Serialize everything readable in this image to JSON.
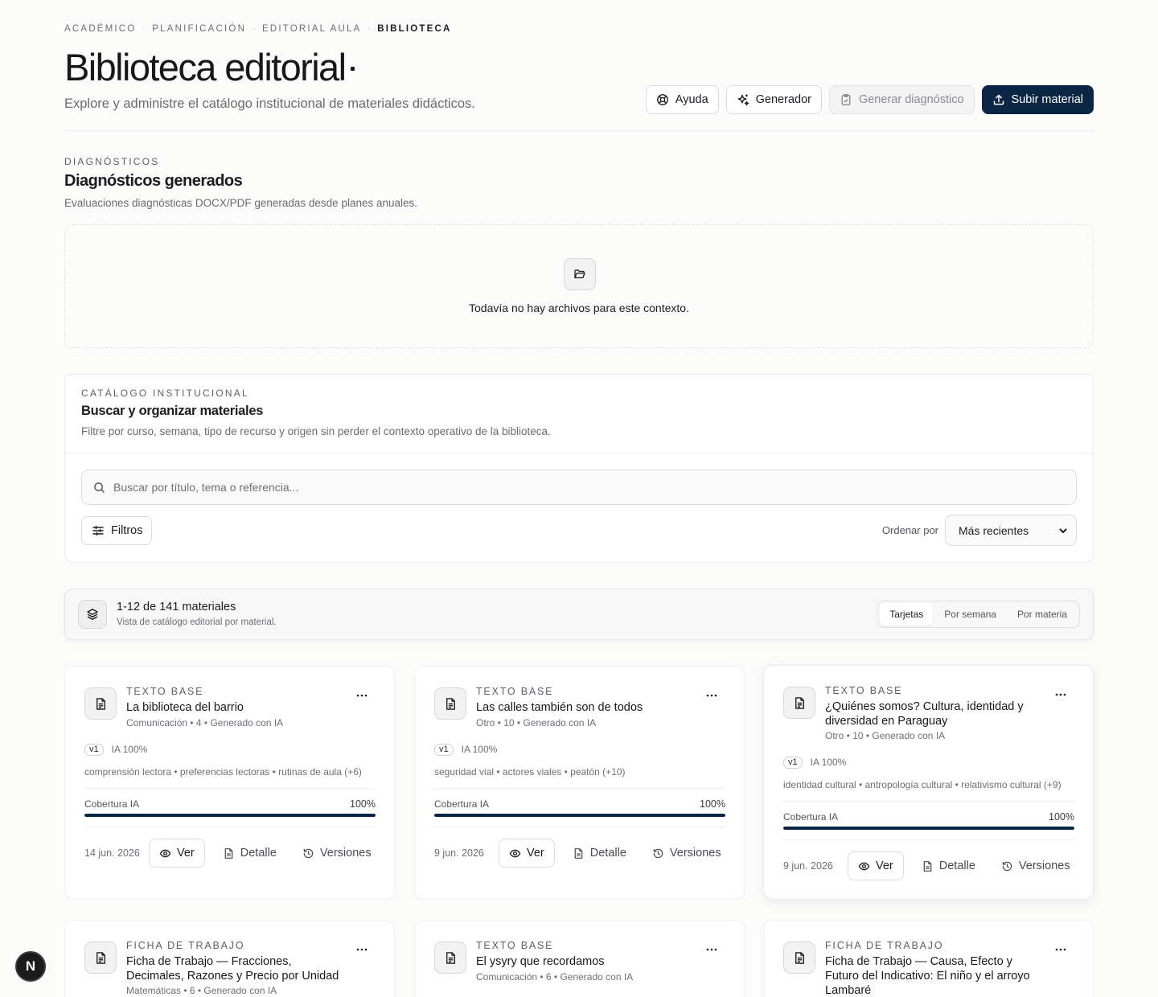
{
  "breadcrumb": [
    "ACADÉMICO",
    "PLANIFICACIÓN",
    "EDITORIAL AULA",
    "BIBLIOTECA"
  ],
  "page": {
    "title": "Biblioteca editorial",
    "subtitle": "Explore y administre el catálogo institucional de materiales didácticos."
  },
  "actions": {
    "help": "Ayuda",
    "generator": "Generador",
    "diagnostic": "Generar diagnóstico",
    "upload": "Subir material"
  },
  "diagnostics": {
    "eyebrow": "DIAGNÓSTICOS",
    "title": "Diagnósticos generados",
    "description": "Evaluaciones diagnósticas DOCX/PDF generadas desde planes anuales.",
    "empty_message": "Todavía no hay archivos para este contexto."
  },
  "catalog": {
    "eyebrow": "CATÁLOGO INSTITUCIONAL",
    "title": "Buscar y organizar materiales",
    "description": "Filtre por curso, semana, tipo de recurso y origen sin perder el contexto operativo de la biblioteca.",
    "search_placeholder": "Buscar por título, tema o referencia...",
    "filters_label": "Filtros",
    "sort_label": "Ordenar por",
    "sort_value": "Más recientes"
  },
  "results": {
    "count": "1-12 de 141 materiales",
    "subtitle": "Vista de catálogo editorial por material.",
    "views": [
      "Tarjetas",
      "Por semana",
      "Por materia"
    ],
    "active_view": "Tarjetas"
  },
  "card_labels": {
    "coverage": "Cobertura IA",
    "view": "Ver",
    "detail": "Detalle",
    "versions": "Versiones"
  },
  "cards": [
    {
      "type": "TEXTO BASE",
      "title": "La biblioteca del barrio",
      "meta": "Comunicación • 4 • Generado con IA",
      "version": "v1",
      "ai": "IA 100%",
      "tags": "comprensión lectora • preferencias lectoras • rutinas de aula (+6)",
      "coverage_pct": "100%",
      "coverage": 1.0,
      "date": "14 jun. 2026"
    },
    {
      "type": "TEXTO BASE",
      "title": "Las calles también son de todos",
      "meta": "Otro • 10 • Generado con IA",
      "version": "v1",
      "ai": "IA 100%",
      "tags": "seguridad vial • actores viales • peatón (+10)",
      "coverage_pct": "100%",
      "coverage": 1.0,
      "date": "9 jun. 2026"
    },
    {
      "type": "TEXTO BASE",
      "title": "¿Quiénes somos? Cultura, identidad y diversidad en Paraguay",
      "meta": "Otro • 10 • Generado con IA",
      "version": "v1",
      "ai": "IA 100%",
      "tags": "identidad cultural • antropología cultural • relativismo cultural (+9)",
      "coverage_pct": "100%",
      "coverage": 1.0,
      "date": "9 jun. 2026"
    },
    {
      "type": "FICHA DE TRABAJO",
      "title": "Ficha de Trabajo — Fracciones, Decimales, Razones y Precio por Unidad",
      "meta": "Matemáticas • 6 • Generado con IA"
    },
    {
      "type": "TEXTO BASE",
      "title": "El ysyry que recordamos",
      "meta": "Comunicación • 6 • Generado con IA"
    },
    {
      "type": "FICHA DE TRABAJO",
      "title": "Ficha de Trabajo — Causa, Efecto y Futuro del Indicativo: El niño y el arroyo Lambaré",
      "meta": ""
    }
  ],
  "fab_label": "N"
}
